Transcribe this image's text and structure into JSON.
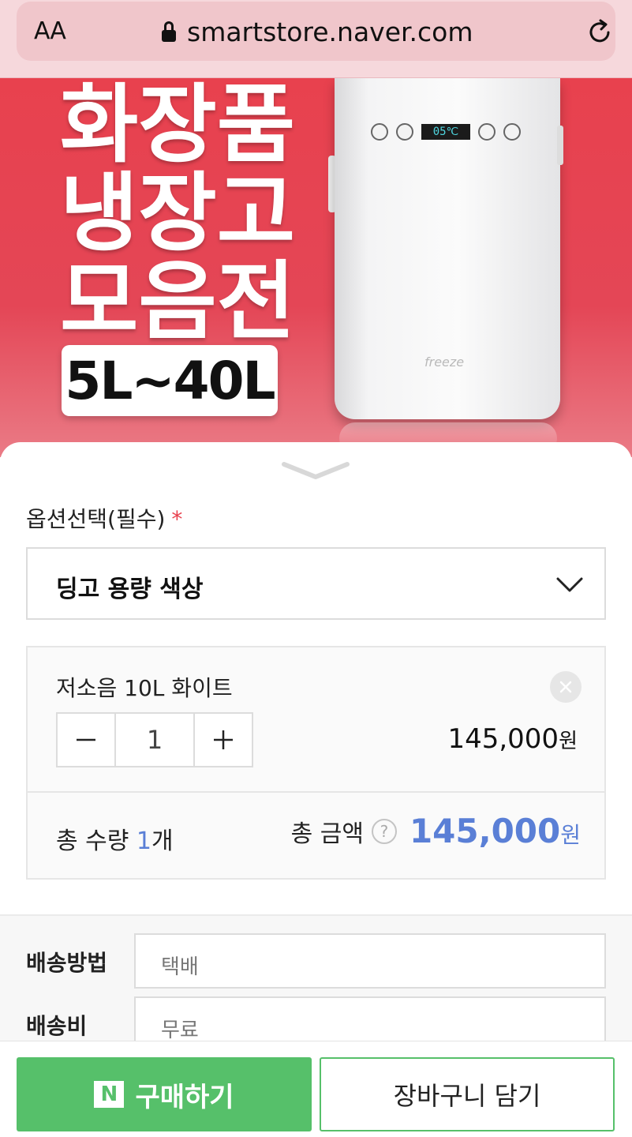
{
  "browser": {
    "text_size_label": "AA",
    "url": "smartstore.naver.com"
  },
  "banner": {
    "title": "화장품\n냉장고\n모음전",
    "capacity": "5L~40L",
    "fridge_display": "05℃",
    "fridge_brand": "freeze"
  },
  "option": {
    "label": "옵션선택(필수)",
    "required_mark": "*",
    "select_value": "딩고 용량 색상"
  },
  "selected_item": {
    "name": "저소음 10L 화이트",
    "quantity": "1",
    "price": "145,000",
    "price_unit": "원"
  },
  "summary": {
    "qty_label": "총 수량",
    "qty_value": "1",
    "qty_unit": "개",
    "amount_label": "총 금액",
    "help": "?",
    "amount_value": "145,000",
    "amount_unit": "원"
  },
  "shipping": {
    "method_label": "배송방법",
    "method_value": "택배",
    "fee_label": "배송비",
    "fee_value": "무료"
  },
  "actions": {
    "npay_icon": "N",
    "buy_label": "구매하기",
    "cart_label": "장바구니 담기"
  },
  "colors": {
    "accent_green": "#56c06a",
    "price_blue": "#5a7fd6",
    "banner_red": "#e8414e"
  }
}
